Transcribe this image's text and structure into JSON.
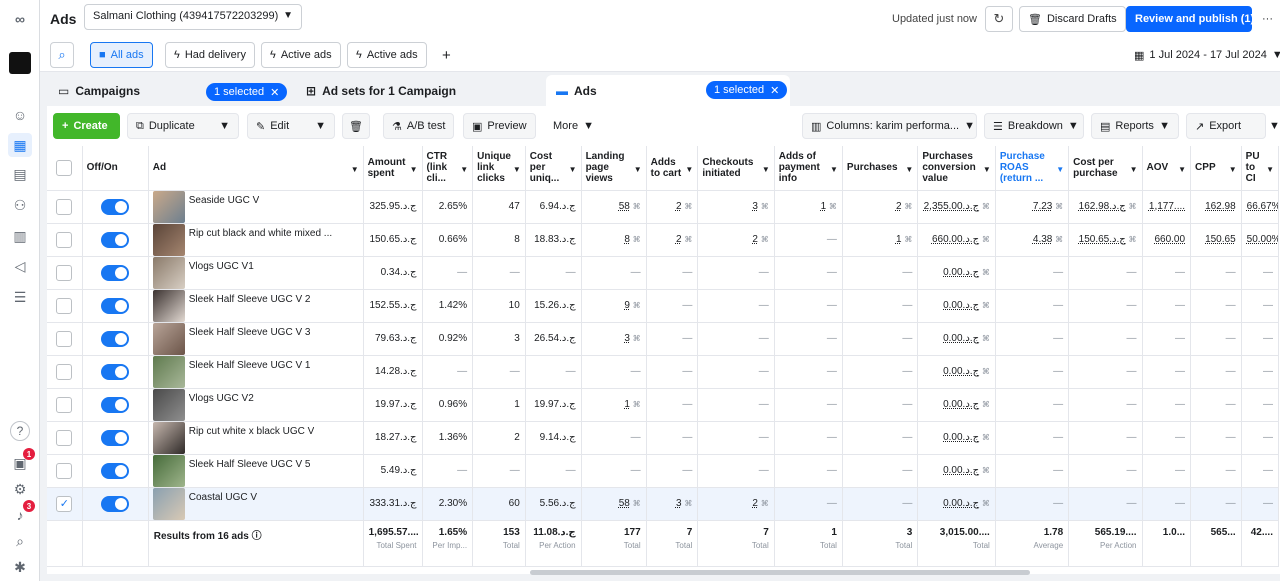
{
  "app": {
    "title": "Ads",
    "account": "Salmani Clothing (439417572203299)",
    "updated": "Updated just now",
    "discard": "Discard Drafts",
    "review": "Review and publish (1)",
    "notif_a": "1",
    "notif_b": "3"
  },
  "filters": {
    "all_ads": "All ads",
    "had_delivery": "Had delivery",
    "active_ads_1": "Active ads",
    "active_ads_2": "Active ads",
    "date_range": "1 Jul 2024 - 17 Jul 2024"
  },
  "tabs": {
    "campaigns": "Campaigns",
    "campaigns_sel": "1 selected",
    "adsets": "Ad sets for 1 Campaign",
    "ads": "Ads",
    "ads_sel": "1 selected"
  },
  "toolbar": {
    "create": "Create",
    "duplicate": "Duplicate",
    "edit": "Edit",
    "ab_test": "A/B test",
    "preview": "Preview",
    "more": "More",
    "columns": "Columns: karim performa...",
    "breakdown": "Breakdown",
    "reports": "Reports",
    "export": "Export"
  },
  "table": {
    "headers": {
      "offon": "Off/On",
      "ad": "Ad",
      "amount": "Amount spent",
      "ctr": "CTR (link cli...",
      "ulc": "Unique link clicks",
      "cpu": "Cost per uniq...",
      "lpv": "Landing page views",
      "atc": "Adds to cart",
      "chk": "Checkouts initiated",
      "api": "Adds of payment info",
      "pur": "Purchases",
      "pcv": "Purchases conversion value",
      "roas": "Purchase ROAS (return ...",
      "cpp": "Cost per purchase",
      "aov": "AOV",
      "cpp2": "CPP",
      "pu": "PU to CI"
    },
    "rows": [
      {
        "name": "Seaside UGC V",
        "amount": "325.95.ج.د",
        "ctr": "2.65%",
        "ulc": "47",
        "cpu": "6.94.ج.د",
        "lpv": "58",
        "atc": "2",
        "chk": "3",
        "api": "1",
        "pur": "2",
        "pcv": "2,355.00.ج.د",
        "roas": "7.23",
        "cpp": "162.98.ج.د",
        "aov": "1,177....",
        "cpp2": "162.98",
        "pu": "66.67%",
        "c1": "#c9a98a",
        "c2": "#6d7f8f",
        "sel": false
      },
      {
        "name": "Rip cut black and white mixed ...",
        "amount": "150.65.ج.د",
        "ctr": "0.66%",
        "ulc": "8",
        "cpu": "18.83.ج.د",
        "lpv": "8",
        "atc": "2",
        "chk": "2",
        "api": "—",
        "pur": "1",
        "pcv": "660.00.ج.د",
        "roas": "4.38",
        "cpp": "150.65.ج.د",
        "aov": "660.00",
        "cpp2": "150.65",
        "pu": "50.00%",
        "c1": "#5a4438",
        "c2": "#a58670",
        "sel": false
      },
      {
        "name": "Vlogs UGC V1",
        "amount": "0.34.ج.د",
        "ctr": "—",
        "ulc": "—",
        "cpu": "—",
        "lpv": "—",
        "atc": "—",
        "chk": "—",
        "api": "—",
        "pur": "—",
        "pcv": "0.00.ج.د",
        "roas": "—",
        "cpp": "—",
        "aov": "—",
        "cpp2": "—",
        "pu": "—",
        "c1": "#8a7a6a",
        "c2": "#d8cfc4",
        "sel": false
      },
      {
        "name": "Sleek Half Sleeve UGC V 2",
        "amount": "152.55.ج.د",
        "ctr": "1.42%",
        "ulc": "10",
        "cpu": "15.26.ج.د",
        "lpv": "9",
        "atc": "—",
        "chk": "—",
        "api": "—",
        "pur": "—",
        "pcv": "0.00.ج.د",
        "roas": "—",
        "cpp": "—",
        "aov": "—",
        "cpp2": "—",
        "pu": "—",
        "c1": "#3b3230",
        "c2": "#e2d9d2",
        "sel": false
      },
      {
        "name": "Sleek Half Sleeve UGC V 3",
        "amount": "79.63.ج.د",
        "ctr": "0.92%",
        "ulc": "3",
        "cpu": "26.54.ج.د",
        "lpv": "3",
        "atc": "—",
        "chk": "—",
        "api": "—",
        "pur": "—",
        "pcv": "0.00.ج.د",
        "roas": "—",
        "cpp": "—",
        "aov": "—",
        "cpp2": "—",
        "pu": "—",
        "c1": "#b8a498",
        "c2": "#6b5448",
        "sel": false
      },
      {
        "name": "Sleek Half Sleeve UGC V 1",
        "amount": "14.28.ج.د",
        "ctr": "—",
        "ulc": "—",
        "cpu": "—",
        "lpv": "—",
        "atc": "—",
        "chk": "—",
        "api": "—",
        "pur": "—",
        "pcv": "0.00.ج.د",
        "roas": "—",
        "cpp": "—",
        "aov": "—",
        "cpp2": "—",
        "pu": "—",
        "c1": "#5f7a4e",
        "c2": "#a9b89a",
        "sel": false
      },
      {
        "name": "Vlogs UGC V2",
        "amount": "19.97.ج.د",
        "ctr": "0.96%",
        "ulc": "1",
        "cpu": "19.97.ج.د",
        "lpv": "1",
        "atc": "—",
        "chk": "—",
        "api": "—",
        "pur": "—",
        "pcv": "0.00.ج.د",
        "roas": "—",
        "cpp": "—",
        "aov": "—",
        "cpp2": "—",
        "pu": "—",
        "c1": "#4a4a4a",
        "c2": "#8f8f8f",
        "sel": false
      },
      {
        "name": "Rip cut white x black UGC V",
        "amount": "18.27.ج.د",
        "ctr": "1.36%",
        "ulc": "2",
        "cpu": "9.14.ج.د",
        "lpv": "—",
        "atc": "—",
        "chk": "—",
        "api": "—",
        "pur": "—",
        "pcv": "0.00.ج.د",
        "roas": "—",
        "cpp": "—",
        "aov": "—",
        "cpp2": "—",
        "pu": "—",
        "c1": "#c6b7ae",
        "c2": "#2f2a28",
        "sel": false
      },
      {
        "name": "Sleek Half Sleeve UGC V 5",
        "amount": "5.49.ج.د",
        "ctr": "—",
        "ulc": "—",
        "cpu": "—",
        "lpv": "—",
        "atc": "—",
        "chk": "—",
        "api": "—",
        "pur": "—",
        "pcv": "0.00.ج.د",
        "roas": "—",
        "cpp": "—",
        "aov": "—",
        "cpp2": "—",
        "pu": "—",
        "c1": "#466b3a",
        "c2": "#9fb58c",
        "sel": false
      },
      {
        "name": "Coastal UGC V",
        "amount": "333.31.ج.د",
        "ctr": "2.30%",
        "ulc": "60",
        "cpu": "5.56.ج.د",
        "lpv": "58",
        "atc": "3",
        "chk": "2",
        "api": "—",
        "pur": "—",
        "pcv": "0.00.ج.د",
        "roas": "—",
        "cpp": "—",
        "aov": "—",
        "cpp2": "—",
        "pu": "—",
        "c1": "#8aa0b0",
        "c2": "#d8c9b5",
        "sel": true
      }
    ],
    "totals": {
      "label": "Results from 16 ads",
      "amount": "1,695.57....",
      "amount_sub": "Total Spent",
      "ctr": "1.65%",
      "ctr_sub": "Per Imp...",
      "ulc": "153",
      "ulc_sub": "Total",
      "cpu": "11.08.ج.د",
      "cpu_sub": "Per Action",
      "lpv": "177",
      "lpv_sub": "Total",
      "atc": "7",
      "atc_sub": "Total",
      "chk": "7",
      "chk_sub": "Total",
      "api": "1",
      "api_sub": "Total",
      "pur": "3",
      "pur_sub": "Total",
      "pcv": "3,015.00....",
      "pcv_sub": "Total",
      "roas": "1.78",
      "roas_sub": "Average",
      "cpp": "565.19....",
      "cpp_sub": "Per Action",
      "aov": "1.0...",
      "cpp2": "565...",
      "pu": "42...."
    }
  }
}
